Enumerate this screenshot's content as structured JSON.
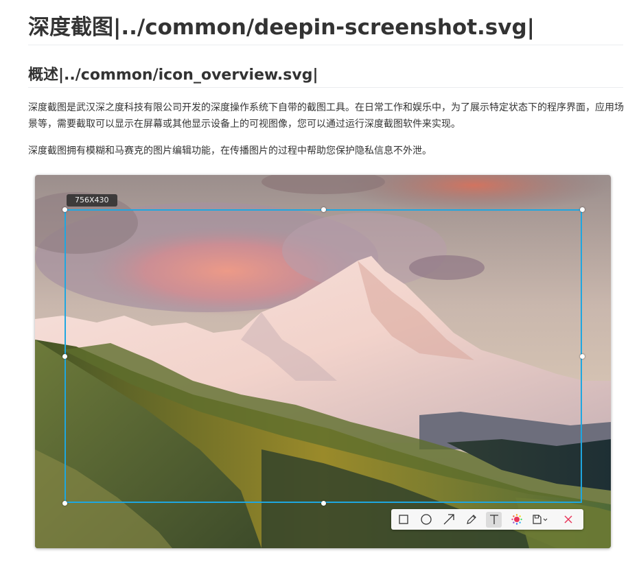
{
  "heading1": "深度截图|../common/deepin-screenshot.svg|",
  "heading2": "概述|../common/icon_overview.svg|",
  "paragraph1": "深度截图是武汉深之度科技有限公司开发的深度操作系统下自带的截图工具。在日常工作和娱乐中，为了展示特定状态下的程序界面，应用场景等，需要截取可以显示在屏幕或其他显示设备上的可视图像，您可以通过运行深度截图软件来实现。",
  "paragraph2": "深度截图拥有模糊和马赛克的图片编辑功能，在传播图片的过程中帮助您保护隐私信息不外泄。",
  "screenshot": {
    "size_label": "756X430",
    "selection_color": "#1ea7e1",
    "toolbar": [
      {
        "icon": "rectangle-icon",
        "active": false
      },
      {
        "icon": "ellipse-icon",
        "active": false
      },
      {
        "icon": "arrow-icon",
        "active": false
      },
      {
        "icon": "pencil-icon",
        "active": false
      },
      {
        "icon": "text-icon",
        "active": true
      },
      {
        "icon": "color-picker-icon",
        "active": false
      },
      {
        "icon": "save-icon",
        "active": false
      },
      {
        "icon": "close-icon",
        "active": false
      }
    ]
  }
}
